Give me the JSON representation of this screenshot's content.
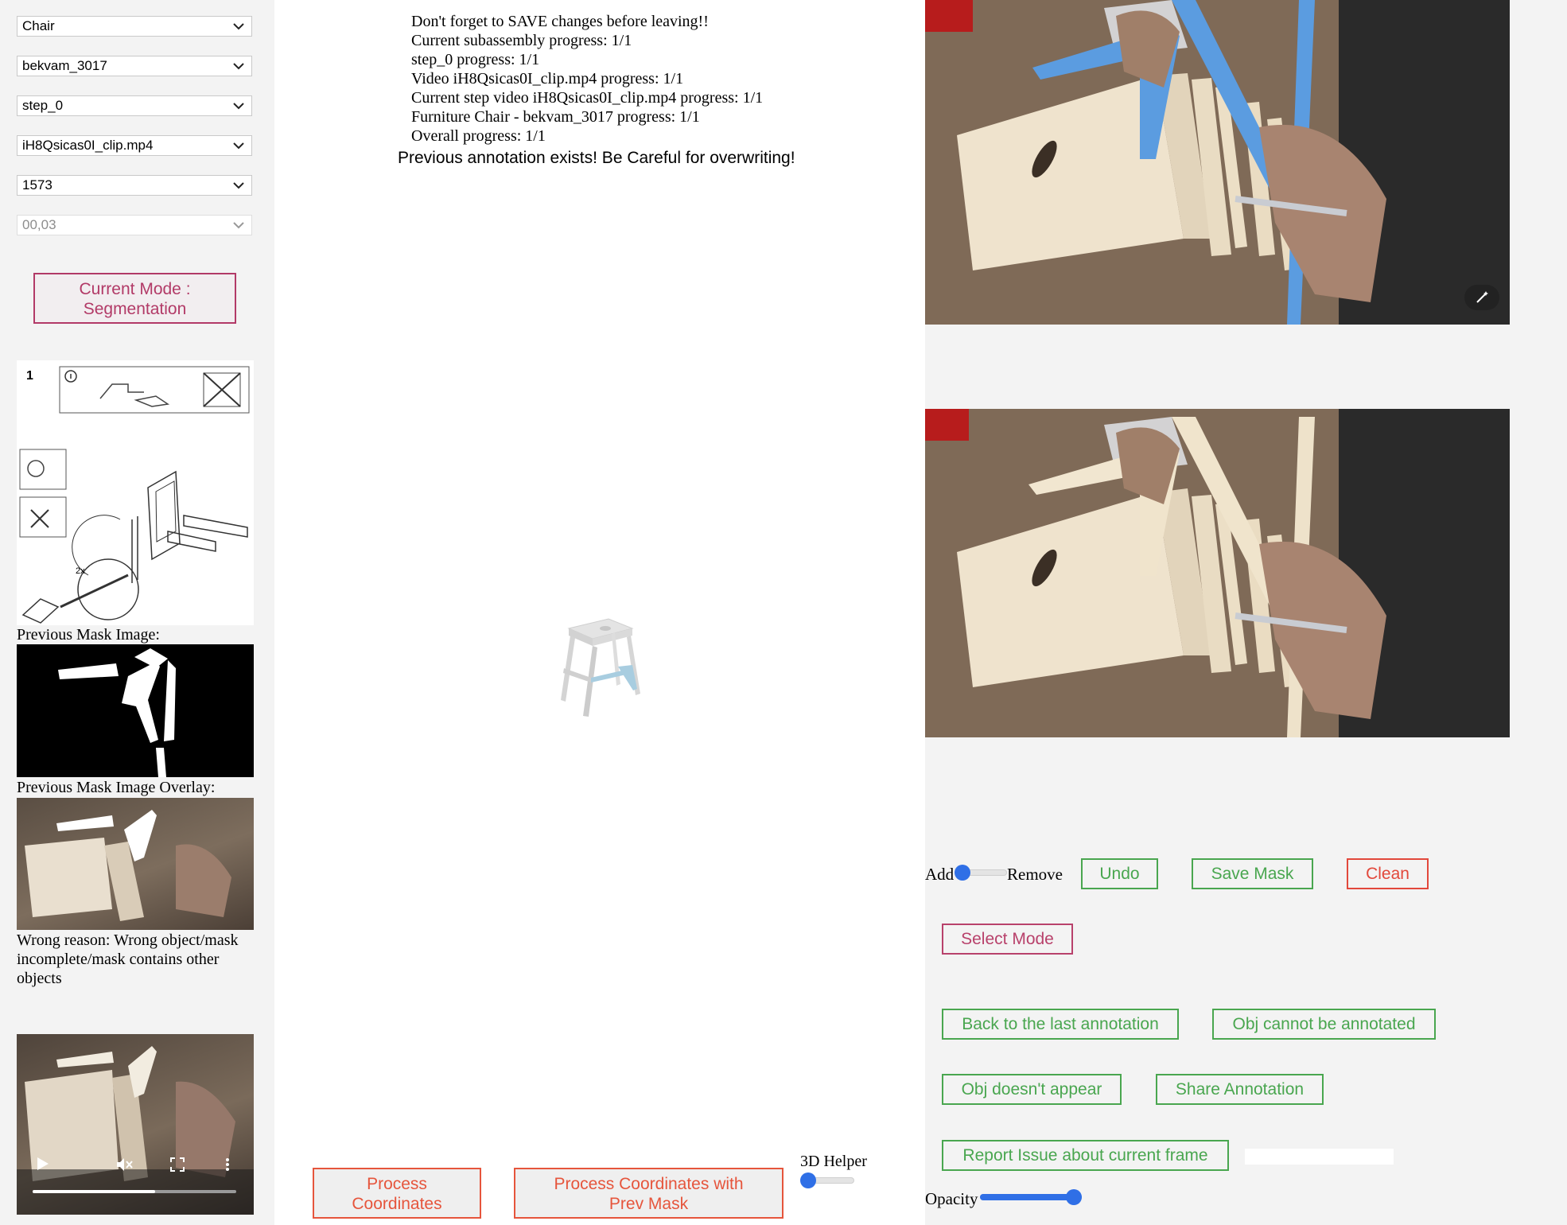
{
  "selects": {
    "furniture": "Chair",
    "subassembly": "bekvam_3017",
    "step": "step_0",
    "video": "iH8Qsicas0I_clip.mp4",
    "frame": "1573",
    "object": "00,03"
  },
  "mode_button": {
    "line1": "Current Mode :",
    "line2": "Segmentation"
  },
  "manual": {
    "step_number": "1",
    "label_2x": "2x"
  },
  "captions": {
    "prev_mask": "Previous Mask Image:",
    "prev_overlay": "Previous Mask Image Overlay:",
    "wrong_reason": "Wrong reason: Wrong object/mask incomplete/mask contains other objects"
  },
  "video_player": {
    "progress": 0.6
  },
  "info": {
    "line1": "Don't forget to SAVE changes before leaving!!",
    "line2": "Current subassembly progress: 1/1",
    "line3": "step_0 progress: 1/1",
    "line4": "Video iH8Qsicas0I_clip.mp4 progress: 1/1",
    "line5": "Current step video iH8Qsicas0I_clip.mp4 progress: 1/1",
    "line6": "Furniture Chair - bekvam_3017 progress: 1/1",
    "line7": "Overall progress: 1/1",
    "warning": "Previous annotation exists! Be Careful for overwriting!"
  },
  "bottom_buttons": {
    "process_line1": "Process",
    "process_line2": "Coordinates",
    "process_prev_line1": "Process Coordinates with",
    "process_prev_line2": "Prev Mask",
    "helper_label": "3D Helper",
    "helper_value": 0
  },
  "controls": {
    "add_label": "Add",
    "remove_label": "Remove",
    "add_remove_value": 0,
    "undo": "Undo",
    "save_mask": "Save Mask",
    "clean": "Clean",
    "select_mode": "Select Mode",
    "back_last": "Back to the last annotation",
    "obj_cannot": "Obj cannot be annotated",
    "obj_not_appear": "Obj doesn't appear",
    "share": "Share Annotation",
    "report": "Report Issue about current frame",
    "report_input": "",
    "opacity_label": "Opacity",
    "opacity_value": 1.0
  },
  "colors": {
    "mode_pink": "#b23a67",
    "green": "#49a64f",
    "red": "#e2483b",
    "slider_blue": "#2f6fe6",
    "mask_blue": "#5b9ce0"
  }
}
